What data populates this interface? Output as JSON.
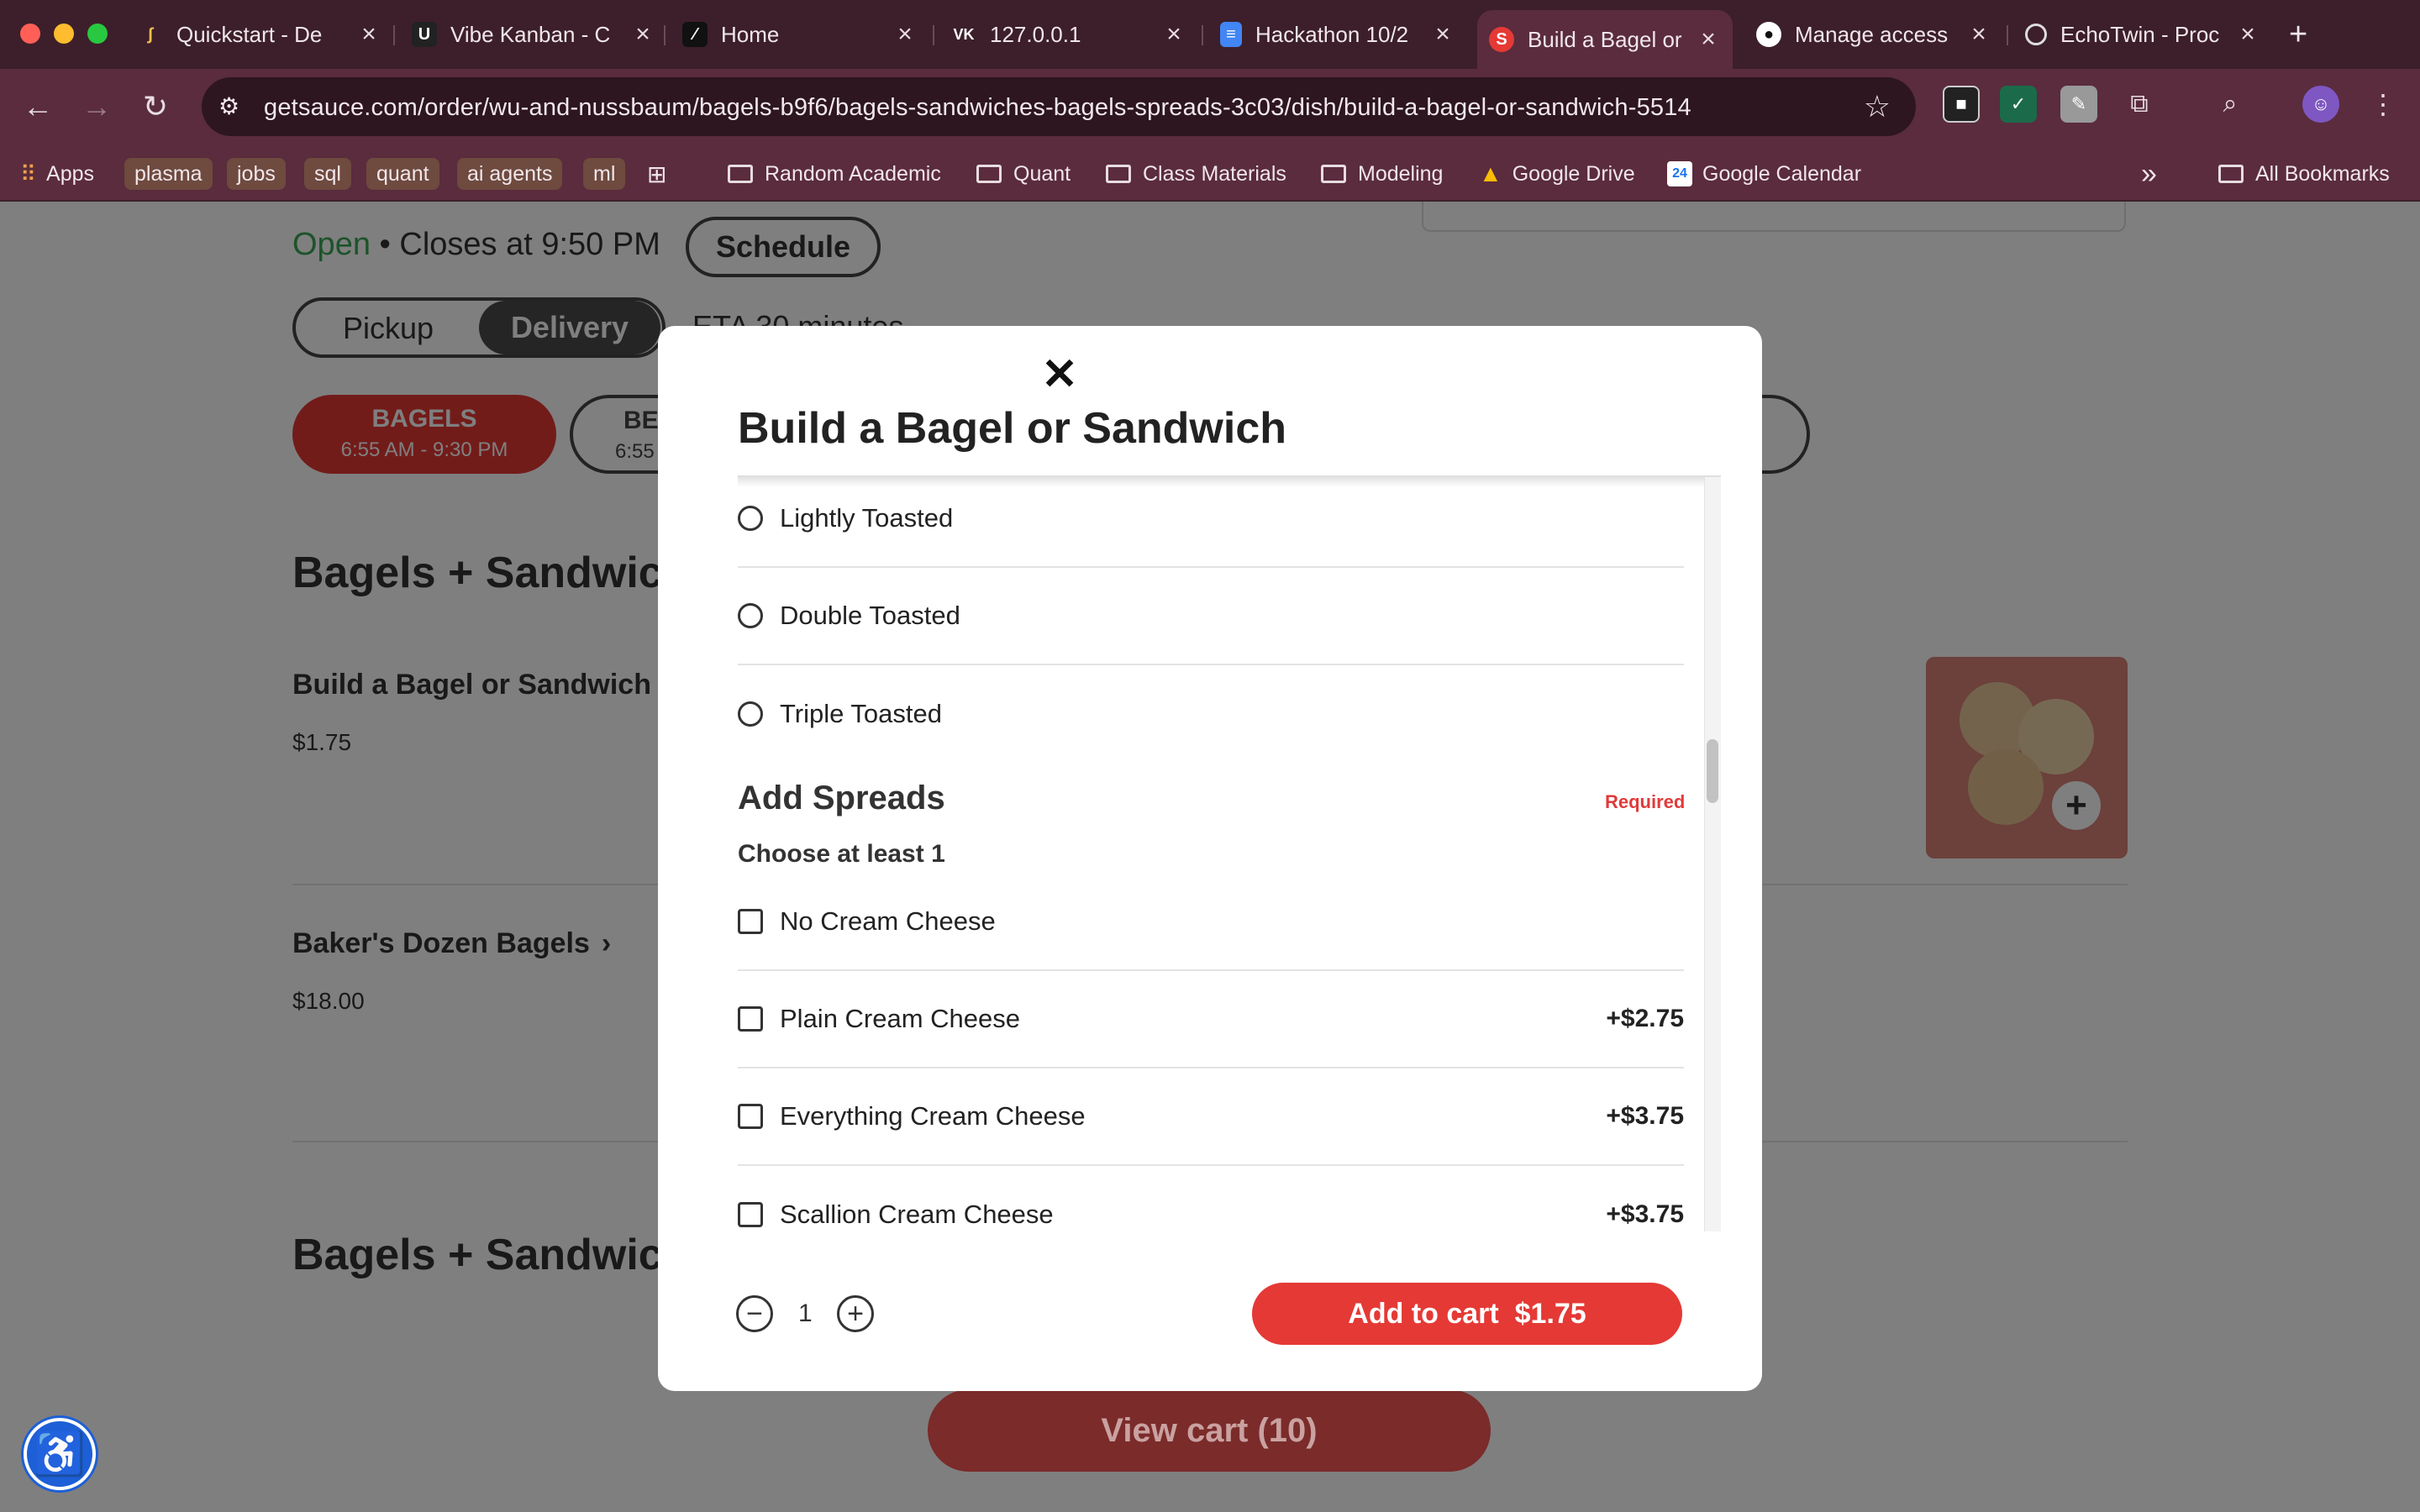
{
  "browser": {
    "tabs": [
      {
        "title": "Quickstart - De",
        "favicon": "quickstart-icon"
      },
      {
        "title": "Vibe Kanban - C",
        "favicon": "vibe-kanban-icon"
      },
      {
        "title": "Home",
        "favicon": "home-slash-icon"
      },
      {
        "title": "127.0.0.1",
        "favicon": "vk-icon",
        "favicon_text": "VK"
      },
      {
        "title": "Hackathon 10/2",
        "favicon": "docs-icon"
      },
      {
        "title": "Build a Bagel or",
        "favicon": "sauce-icon",
        "favicon_text": "S",
        "active": true
      },
      {
        "title": "Manage access",
        "favicon": "github-icon"
      },
      {
        "title": "EchoTwin - Proc",
        "favicon": "globe-icon"
      }
    ],
    "new_tab": "+",
    "url": "getsauce.com/order/wu-and-nussbaum/bagels-b9f6/bagels-sandwiches-bagels-spreads-3c03/dish/build-a-bagel-or-sandwich-5514",
    "bookmarks": {
      "apps": "Apps",
      "chips": [
        "plasma",
        "jobs",
        "sql",
        "quant",
        "ai agents",
        "ml"
      ],
      "folders": [
        "Random Academic",
        "Quant",
        "Class Materials",
        "Modeling"
      ],
      "links": [
        "Google Drive",
        "Google Calendar"
      ],
      "all_bookmarks": "All Bookmarks",
      "overflow": "»"
    }
  },
  "page": {
    "status_open": "Open",
    "status_close": " • Closes at 9:50 PM",
    "schedule": "Schedule",
    "pickup": "Pickup",
    "delivery": "Delivery",
    "eta": "ETA 30 minutes",
    "menu_tab_1_title": "BAGELS",
    "menu_tab_1_hours": "6:55 AM - 9:30 PM",
    "menu_tab_2_title": "BE",
    "menu_tab_2_hours": "6:55",
    "section_heading": "Bagels + Sandwich",
    "item_1_name": "Build a Bagel or Sandwich",
    "item_1_price": "$1.75",
    "item_2_name": "Baker's Dozen Bagels",
    "item_2_price": "$18.00",
    "section_heading_2": "Bagels + Sandwich",
    "view_cart": "View cart (10)"
  },
  "modal": {
    "title": "Build a Bagel or Sandwich",
    "close": "✕",
    "toast_options": [
      "Lightly Toasted",
      "Double Toasted",
      "Triple Toasted"
    ],
    "spreads": {
      "title": "Add Spreads",
      "required": "Required",
      "subtitle": "Choose at least 1",
      "options": [
        {
          "label": "No Cream Cheese",
          "price": ""
        },
        {
          "label": "Plain Cream Cheese",
          "price": "+$2.75"
        },
        {
          "label": "Everything Cream Cheese",
          "price": "+$3.75"
        },
        {
          "label": "Scallion Cream Cheese",
          "price": "+$3.75"
        }
      ]
    },
    "quantity": "1",
    "add_to_cart": "Add to cart  $1.75"
  },
  "colors": {
    "accent_red": "#e53935",
    "open_green": "#3aa655",
    "chrome_bg": "#5a2c3d"
  }
}
